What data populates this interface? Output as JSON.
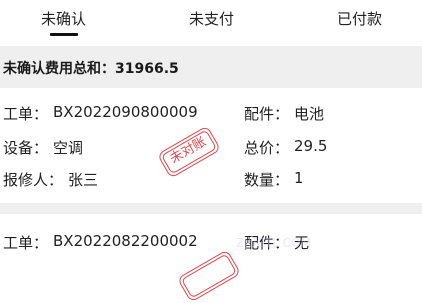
{
  "tabs": [
    {
      "label": "未确认"
    },
    {
      "label": "未支付"
    },
    {
      "label": "已付款"
    }
  ],
  "summary": {
    "text": "未确认费用总和：31966.5"
  },
  "cards": [
    {
      "order_label": "工单：",
      "order_value": "BX2022090800009",
      "part_label": "配件：",
      "part_value": "电池",
      "device_label": "设备：",
      "device_value": "空调",
      "price_label": "总价：",
      "price_value": "29.5",
      "reporter_label": "报修人：",
      "reporter_value": "张三",
      "qty_label": "数量：",
      "qty_value": "1",
      "stamp": "未对账"
    },
    {
      "order_label": "工单：",
      "order_value": "BX2022082200002",
      "part_label": "配件：",
      "part_value": "无"
    }
  ],
  "watermark": "ZJUCTL COM"
}
